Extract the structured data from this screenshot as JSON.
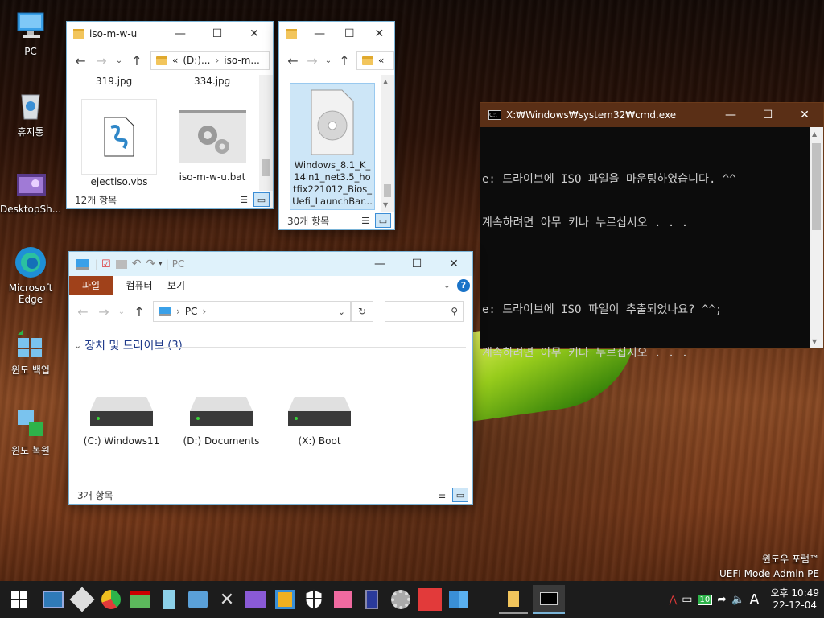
{
  "desktop": {
    "icons": [
      {
        "label": "PC",
        "icon": "pc-icon"
      },
      {
        "label": "휴지통",
        "icon": "recycle-bin-icon"
      },
      {
        "label": "DesktopSh...",
        "icon": "desktop-shortcut-icon"
      },
      {
        "label": "Microsoft Edge",
        "icon": "edge-icon"
      },
      {
        "label": "윈도 백업",
        "icon": "backup-icon"
      },
      {
        "label": "윈도 복원",
        "icon": "restore-icon"
      }
    ],
    "watermark": {
      "line1": "윈도우 포럼™",
      "line2": "UEFI Mode Admin PE"
    }
  },
  "explorer1": {
    "title": "iso-m-w-u",
    "address": [
      "«",
      "(D:)...",
      "iso-m..."
    ],
    "partial_files": [
      "319.jpg",
      "334.jpg"
    ],
    "files": [
      {
        "name": "ejectiso.vbs",
        "icon": "vbs-script-icon"
      },
      {
        "name": "iso-m-w-u.bat",
        "icon": "bat-gear-icon"
      }
    ],
    "status": "12개 항목"
  },
  "explorer2": {
    "title": "",
    "address": "«",
    "files": [
      {
        "name": "Windows_8.1_K_14in1_net3.5_hotfix221012_Bios_Uefi_LaunchBar...",
        "icon": "disc-image-icon"
      }
    ],
    "file_label_lines": [
      "Windows_8.1_K_",
      "14in1_net3.5_ho",
      "tfix221012_Bios_",
      "Uefi_LaunchBar..."
    ],
    "status": "30개 항목"
  },
  "explorer3": {
    "title": "PC",
    "ribbon_tabs": [
      "파일",
      "컴퓨터",
      "보기"
    ],
    "address": "PC",
    "search_placeholder": "",
    "section_title": "장치 및 드라이브",
    "section_count": "(3)",
    "drives": [
      {
        "label": "(C:) Windows11"
      },
      {
        "label": "(D:) Documents"
      },
      {
        "label": "(X:) Boot"
      }
    ],
    "status": "3개 항목"
  },
  "cmd": {
    "title": "X:₩Windows₩system32₩cmd.exe",
    "lines": [
      "e: 드라이브에 ISO 파일을 마운팅하였습니다. ^^",
      "계속하려면 아무 키나 누르십시오 . . .",
      "",
      "e: 드라이브에 ISO 파일이 추출되었나요? ^^;",
      "계속하려면 아무 키나 누르십시오 . . ."
    ]
  },
  "taskbar": {
    "tray_badge": "10",
    "ime": "A",
    "time": "오후 10:49",
    "date": "22-12-04"
  },
  "colors": {
    "ribbon_file_tab": "#a0411a",
    "accent": "#3c8ed6",
    "cmd_title": "#5a2f16",
    "taskbar": "#1c1c1c"
  }
}
